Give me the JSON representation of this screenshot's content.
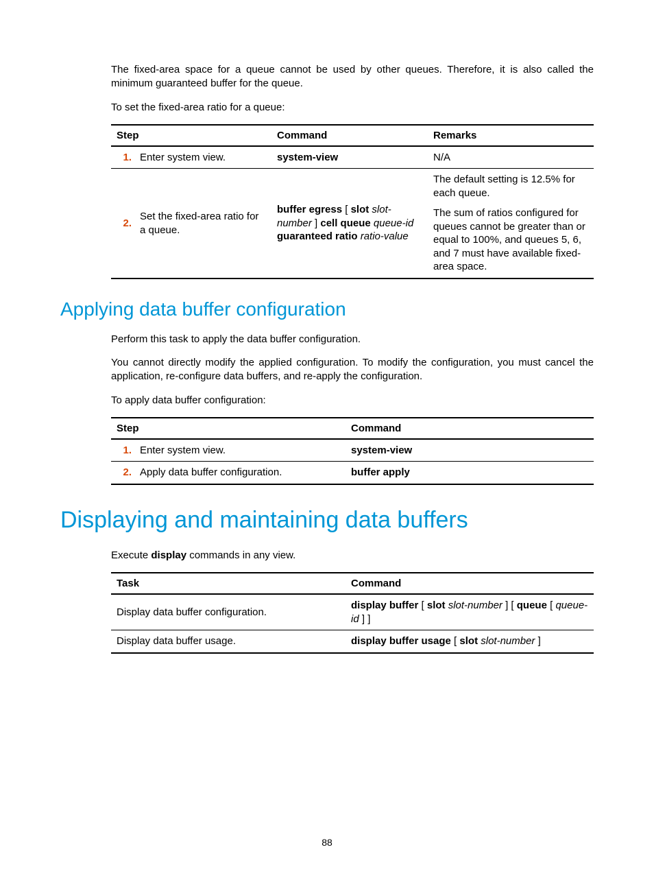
{
  "intro": {
    "p1": "The fixed-area space for a queue cannot be used by other queues. Therefore, it is also called the minimum guaranteed buffer for the queue.",
    "p2": "To set the fixed-area ratio for a queue:"
  },
  "table1": {
    "h_step": "Step",
    "h_command": "Command",
    "h_remarks": "Remarks",
    "r1": {
      "num": "1.",
      "step": "Enter system view.",
      "cmd_b": "system-view",
      "remarks": "N/A"
    },
    "r2": {
      "num": "2.",
      "step": "Set the fixed-area ratio for a queue.",
      "cmd_b1": "buffer egress",
      "cmd_t1": " [ ",
      "cmd_b2": "slot",
      "cmd_i1": " slot-number",
      "cmd_t2": " ] ",
      "cmd_b3": "cell queue",
      "cmd_i2": " queue-id ",
      "cmd_b4": "guaranteed ratio",
      "cmd_i3": " ratio-value",
      "remarks1": "The default setting is 12.5% for each queue.",
      "remarks2": "The sum of ratios configured for queues cannot be greater than or equal to 100%, and queues 5, 6, and 7 must have available fixed-area space."
    }
  },
  "section2": {
    "title": "Applying data buffer configuration",
    "p1": "Perform this task to apply the data buffer configuration.",
    "p2": "You cannot directly modify the applied configuration. To modify the configuration, you must cancel the application, re-configure data buffers, and re-apply the configuration.",
    "p3": "To apply data buffer configuration:"
  },
  "table2": {
    "h_step": "Step",
    "h_command": "Command",
    "r1": {
      "num": "1.",
      "step": "Enter system view.",
      "cmd": "system-view"
    },
    "r2": {
      "num": "2.",
      "step": "Apply data buffer configuration.",
      "cmd": "buffer apply"
    }
  },
  "chapter": {
    "title": "Displaying and maintaining data buffers",
    "p1_a": "Execute ",
    "p1_b": "display",
    "p1_c": " commands in any view."
  },
  "table3": {
    "h_task": "Task",
    "h_command": "Command",
    "r1": {
      "task": "Display data buffer configuration.",
      "c_b1": "display buffer",
      "c_t1": " [ ",
      "c_b2": "slot",
      "c_i1": " slot-number",
      "c_t2": " ] [ ",
      "c_b3": "queue",
      "c_t3": " [ ",
      "c_i2": "queue-id",
      "c_t4": " ] ]"
    },
    "r2": {
      "task": "Display data buffer usage.",
      "c_b1": "display buffer usage",
      "c_t1": " [ ",
      "c_b2": "slot",
      "c_i1": " slot-number",
      "c_t2": " ]"
    }
  },
  "pagenum": "88"
}
